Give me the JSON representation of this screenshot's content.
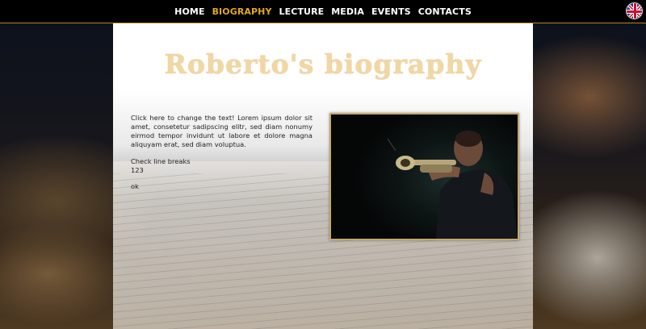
{
  "nav": {
    "items": [
      {
        "label": "HOME",
        "active": false
      },
      {
        "label": "BIOGRAPHY",
        "active": true
      },
      {
        "label": "LECTURE",
        "active": false
      },
      {
        "label": "MEDIA",
        "active": false
      },
      {
        "label": "EVENTS",
        "active": false
      },
      {
        "label": "CONTACTS",
        "active": false
      }
    ],
    "language_icon": "uk-flag-icon"
  },
  "page": {
    "title": "Roberto's biography",
    "paragraph1": "Click here to change the text! Lorem ipsum dolor sit amet, consetetur sadipscing elitr, sed diam nonumy eirmod tempor invidunt ut labore et dolore magna aliquyam erat, sed diam voluptua.",
    "line1": "Check line breaks",
    "line2": "123",
    "line3": "ok"
  },
  "colors": {
    "accent": "#e3a624",
    "nav_background": "#000000",
    "title": "#f2d7a2"
  }
}
